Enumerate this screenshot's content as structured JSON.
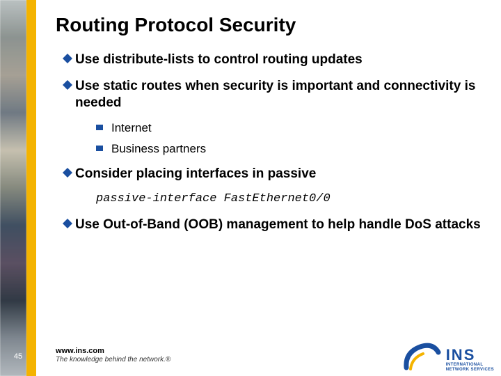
{
  "title": "Routing Protocol Security",
  "bullets": {
    "b1": "Use distribute-lists to control routing updates",
    "b2": "Use static routes when security is important and connectivity is needed",
    "b2_sub1": "Internet",
    "b2_sub2": "Business partners",
    "b3": "Consider placing interfaces in passive",
    "b3_code": "passive-interface FastEthernet0/0",
    "b4": "Use Out-of-Band (OOB) management to help handle DoS attacks"
  },
  "footer": {
    "page": "45",
    "url": "www.ins.com",
    "tagline": "The knowledge behind the network.®"
  },
  "logo": {
    "abbrev": "INS",
    "line1": "INTERNATIONAL",
    "line2": "NETWORK SERVICES"
  },
  "colors": {
    "accent_yellow": "#f4b300",
    "bullet_blue": "#1a4fa0"
  }
}
